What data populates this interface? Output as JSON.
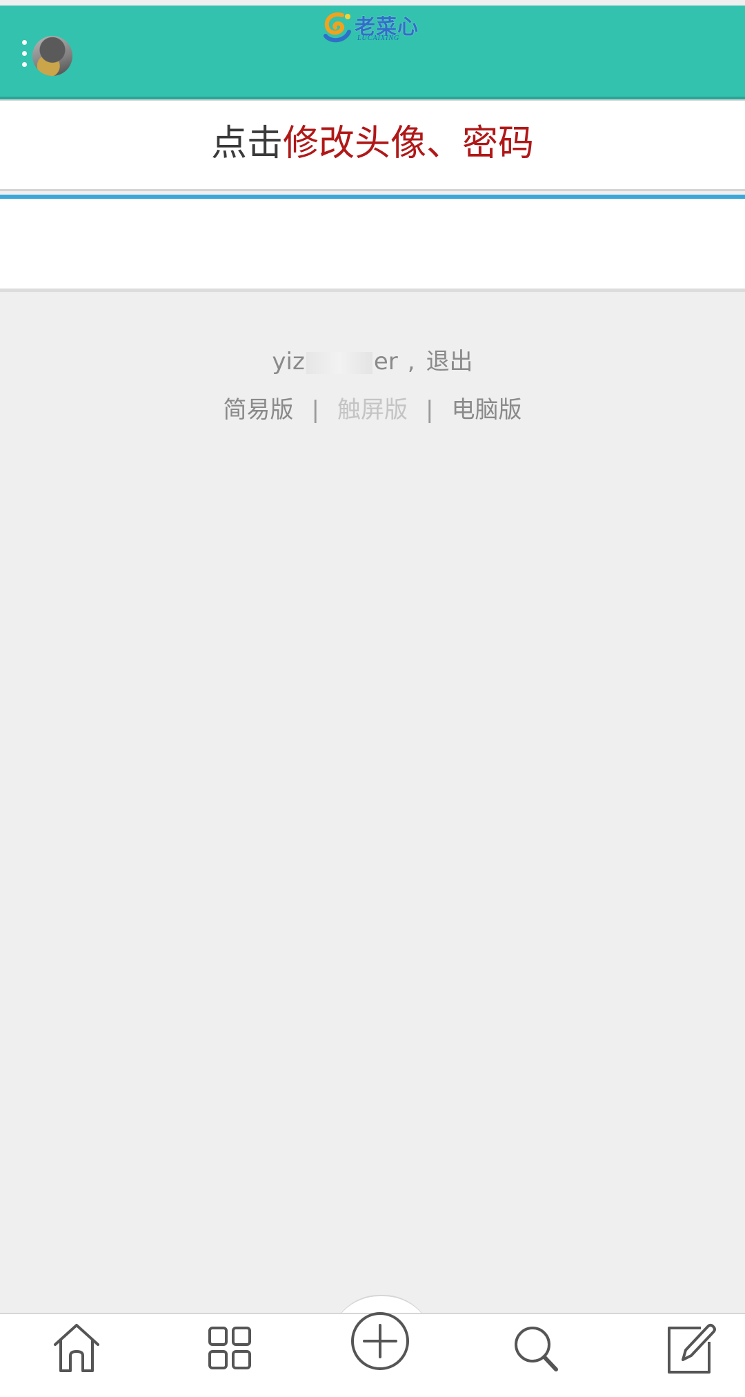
{
  "header": {
    "logo_text": "老菜心",
    "logo_subtext": "LUCAIXING",
    "menu_icon": "more-vertical-icon",
    "avatar_icon": "user-avatar",
    "background_color": "#33c2ad"
  },
  "promo": {
    "prefix": "点击",
    "emphasis": "修改头像、密码",
    "emphasis_color": "#b01818"
  },
  "account": {
    "username_start": "yiz",
    "username_end": "er",
    "separator": ",",
    "logout_label": "退出"
  },
  "versions": {
    "simple_label": "简易版",
    "divider": "|",
    "touch_label": "触屏版",
    "desktop_label": "电脑版"
  },
  "bottom_nav": {
    "items": [
      {
        "icon": "home-icon"
      },
      {
        "icon": "grid-icon"
      },
      {
        "icon": "add-circle-icon"
      },
      {
        "icon": "search-icon"
      },
      {
        "icon": "edit-icon"
      }
    ]
  }
}
